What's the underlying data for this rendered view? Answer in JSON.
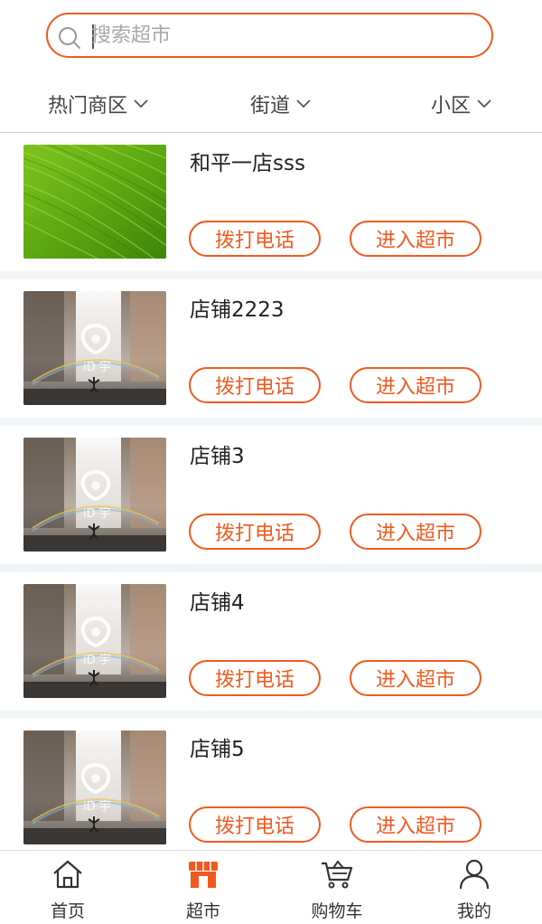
{
  "search": {
    "placeholder": "搜索超市"
  },
  "filters": [
    {
      "label": "热门商区"
    },
    {
      "label": "街道"
    },
    {
      "label": "小区"
    }
  ],
  "stores": [
    {
      "name": "和平一店sss",
      "image": "green-leaf",
      "call_label": "拨打电话",
      "enter_label": "进入超市"
    },
    {
      "name": "店铺2223",
      "image": "waterfall",
      "call_label": "拨打电话",
      "enter_label": "进入超市"
    },
    {
      "name": "店铺3",
      "image": "waterfall",
      "call_label": "拨打电话",
      "enter_label": "进入超市"
    },
    {
      "name": "店铺4",
      "image": "waterfall",
      "call_label": "拨打电话",
      "enter_label": "进入超市"
    },
    {
      "name": "店铺5",
      "image": "waterfall",
      "call_label": "拨打电话",
      "enter_label": "进入超市"
    }
  ],
  "tabbar": {
    "items": [
      {
        "label": "首页",
        "icon": "home-icon"
      },
      {
        "label": "超市",
        "icon": "store-icon",
        "active": true
      },
      {
        "label": "购物车",
        "icon": "cart-icon"
      },
      {
        "label": "我的",
        "icon": "user-icon"
      }
    ]
  },
  "colors": {
    "accent": "#f05a1f",
    "background": "#f2f5f7"
  }
}
